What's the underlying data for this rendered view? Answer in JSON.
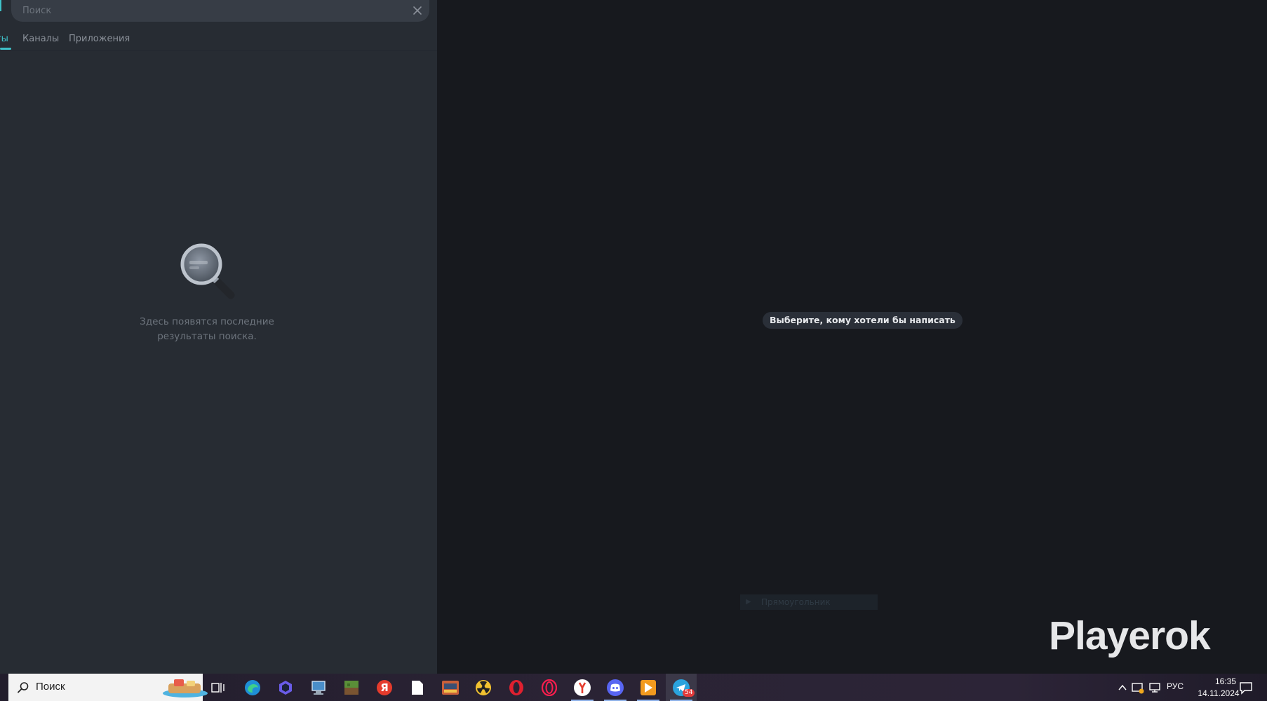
{
  "search": {
    "placeholder": "Поиск"
  },
  "tabs": [
    {
      "label": "ты"
    },
    {
      "label": "Каналы"
    },
    {
      "label": "Приложения"
    }
  ],
  "empty_state": {
    "text": "Здесь появятся последние результаты поиска."
  },
  "chat_area": {
    "select_chat_hint": "Выберите, кому хотели бы написать",
    "ghost_label": "Прямоугольник"
  },
  "watermark": "Playerok",
  "taskbar": {
    "search_text": "Поиск",
    "lang": "РУС",
    "time": "16:35",
    "date": "14.11.2024",
    "telegram_badge": "54"
  },
  "colors": {
    "accent": "#3fc2c9",
    "left_panel_bg": "#272c33",
    "right_panel_bg": "#17191e"
  }
}
